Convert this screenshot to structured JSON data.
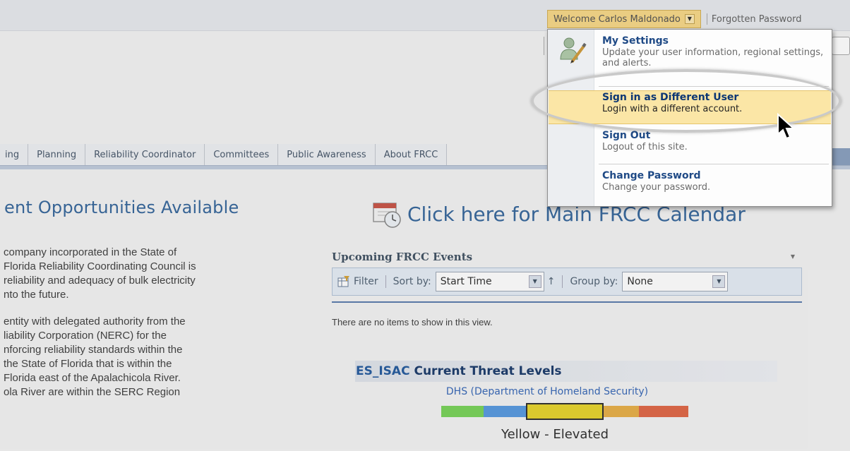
{
  "header": {
    "welcome_label": "Welcome Carlos Maldonado",
    "welcome_caret": "▼",
    "forgotten_password": "Forgotten Password"
  },
  "nav": {
    "tabs": [
      "ing",
      "Planning",
      "Reliability Coordinator",
      "Committees",
      "Public Awareness",
      "About FRCC"
    ]
  },
  "left": {
    "title": "ent Opportunities Available",
    "paragraph1": [
      "company incorporated in the State of",
      "Florida Reliability Coordinating Council is",
      "reliability and adequacy of bulk electricity",
      "nto the future."
    ],
    "paragraph2": [
      "entity with delegated authority from the",
      "liability Corporation (NERC) for the",
      "nforcing reliability standards within the",
      "the State of Florida that is within the",
      "Florida east of the Apalachicola River.",
      "ola River are within the SERC Region"
    ]
  },
  "calendar": {
    "link_text": "Click here for Main FRCC Calendar"
  },
  "events": {
    "title": "Upcoming FRCC Events",
    "dropdown_glyph": "▼",
    "filter_label": "Filter",
    "sort_by_label": "Sort by:",
    "sort_value": "Start Time",
    "sort_arrow": "↑",
    "group_by_label": "Group by:",
    "group_value": "None",
    "empty_message": "There are no items to show in this view."
  },
  "threat": {
    "title_prefix": "ES_ISAC",
    "title_rest": " Current Threat Levels",
    "source": "DHS (Department of Homeland Security)",
    "level_label": "Yellow - Elevated",
    "level_colors": [
      "#7bd35c",
      "#5b9be0",
      "#e6d431",
      "#e7b04b",
      "#e06a4a"
    ]
  },
  "menu": {
    "items": [
      {
        "title": "My Settings",
        "desc": "Update your user information, regional settings, and alerts."
      },
      {
        "title": "Sign in as Different User",
        "desc": "Login with a different account."
      },
      {
        "title": "Sign Out",
        "desc": "Logout of this site."
      },
      {
        "title": "Change Password",
        "desc": "Change your password."
      }
    ]
  }
}
